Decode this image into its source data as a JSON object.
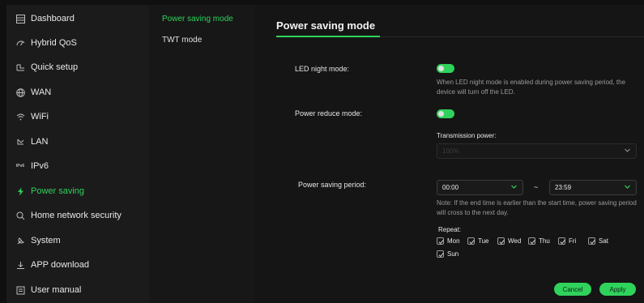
{
  "sidebar": {
    "items": [
      {
        "label": "Dashboard",
        "icon": "dashboard-icon"
      },
      {
        "label": "Hybrid QoS",
        "icon": "qos-icon"
      },
      {
        "label": "Quick setup",
        "icon": "quick-setup-icon"
      },
      {
        "label": "WAN",
        "icon": "globe-icon"
      },
      {
        "label": "WiFi",
        "icon": "wifi-icon"
      },
      {
        "label": "LAN",
        "icon": "lan-icon"
      },
      {
        "label": "IPv6",
        "icon": "ipv6-icon",
        "icon_text": "IPv6"
      },
      {
        "label": "Power saving",
        "icon": "lightning-icon",
        "active": true
      },
      {
        "label": "Home network security",
        "icon": "security-icon"
      },
      {
        "label": "System",
        "icon": "system-icon"
      },
      {
        "label": "APP download",
        "icon": "download-icon"
      },
      {
        "label": "User manual",
        "icon": "manual-icon"
      }
    ]
  },
  "submenu": {
    "items": [
      {
        "label": "Power saving mode",
        "active": true
      },
      {
        "label": "TWT mode"
      }
    ]
  },
  "main": {
    "title": "Power saving mode",
    "led_night_mode": {
      "label": "LED night mode:",
      "enabled": true,
      "note": "When LED night mode is enabled during power saving period, the device will turn off the LED."
    },
    "power_reduce_mode": {
      "label": "Power reduce mode:",
      "enabled": true
    },
    "transmission_power": {
      "label": "Transmission power:",
      "value": "100%"
    },
    "power_saving_period": {
      "label": "Power saving period:",
      "start": "00:00",
      "separator": "~",
      "end": "23:59",
      "note": "Note: If the end time is earlier than the start time, power saving period will cross to the next day."
    },
    "repeat": {
      "label": "Repeat:",
      "days": [
        {
          "label": "Mon",
          "checked": true
        },
        {
          "label": "Tue",
          "checked": true
        },
        {
          "label": "Wed",
          "checked": true
        },
        {
          "label": "Thu",
          "checked": true
        },
        {
          "label": "Fri",
          "checked": true
        },
        {
          "label": "Sat",
          "checked": true
        },
        {
          "label": "Sun",
          "checked": true
        }
      ]
    },
    "buttons": {
      "cancel": "Cancel",
      "apply": "Apply"
    }
  },
  "colors": {
    "accent": "#2fd35b",
    "background": "#101010",
    "sidebar": "#1b1b1b",
    "text": "#e6e6e6",
    "muted": "#9a9a9a"
  }
}
